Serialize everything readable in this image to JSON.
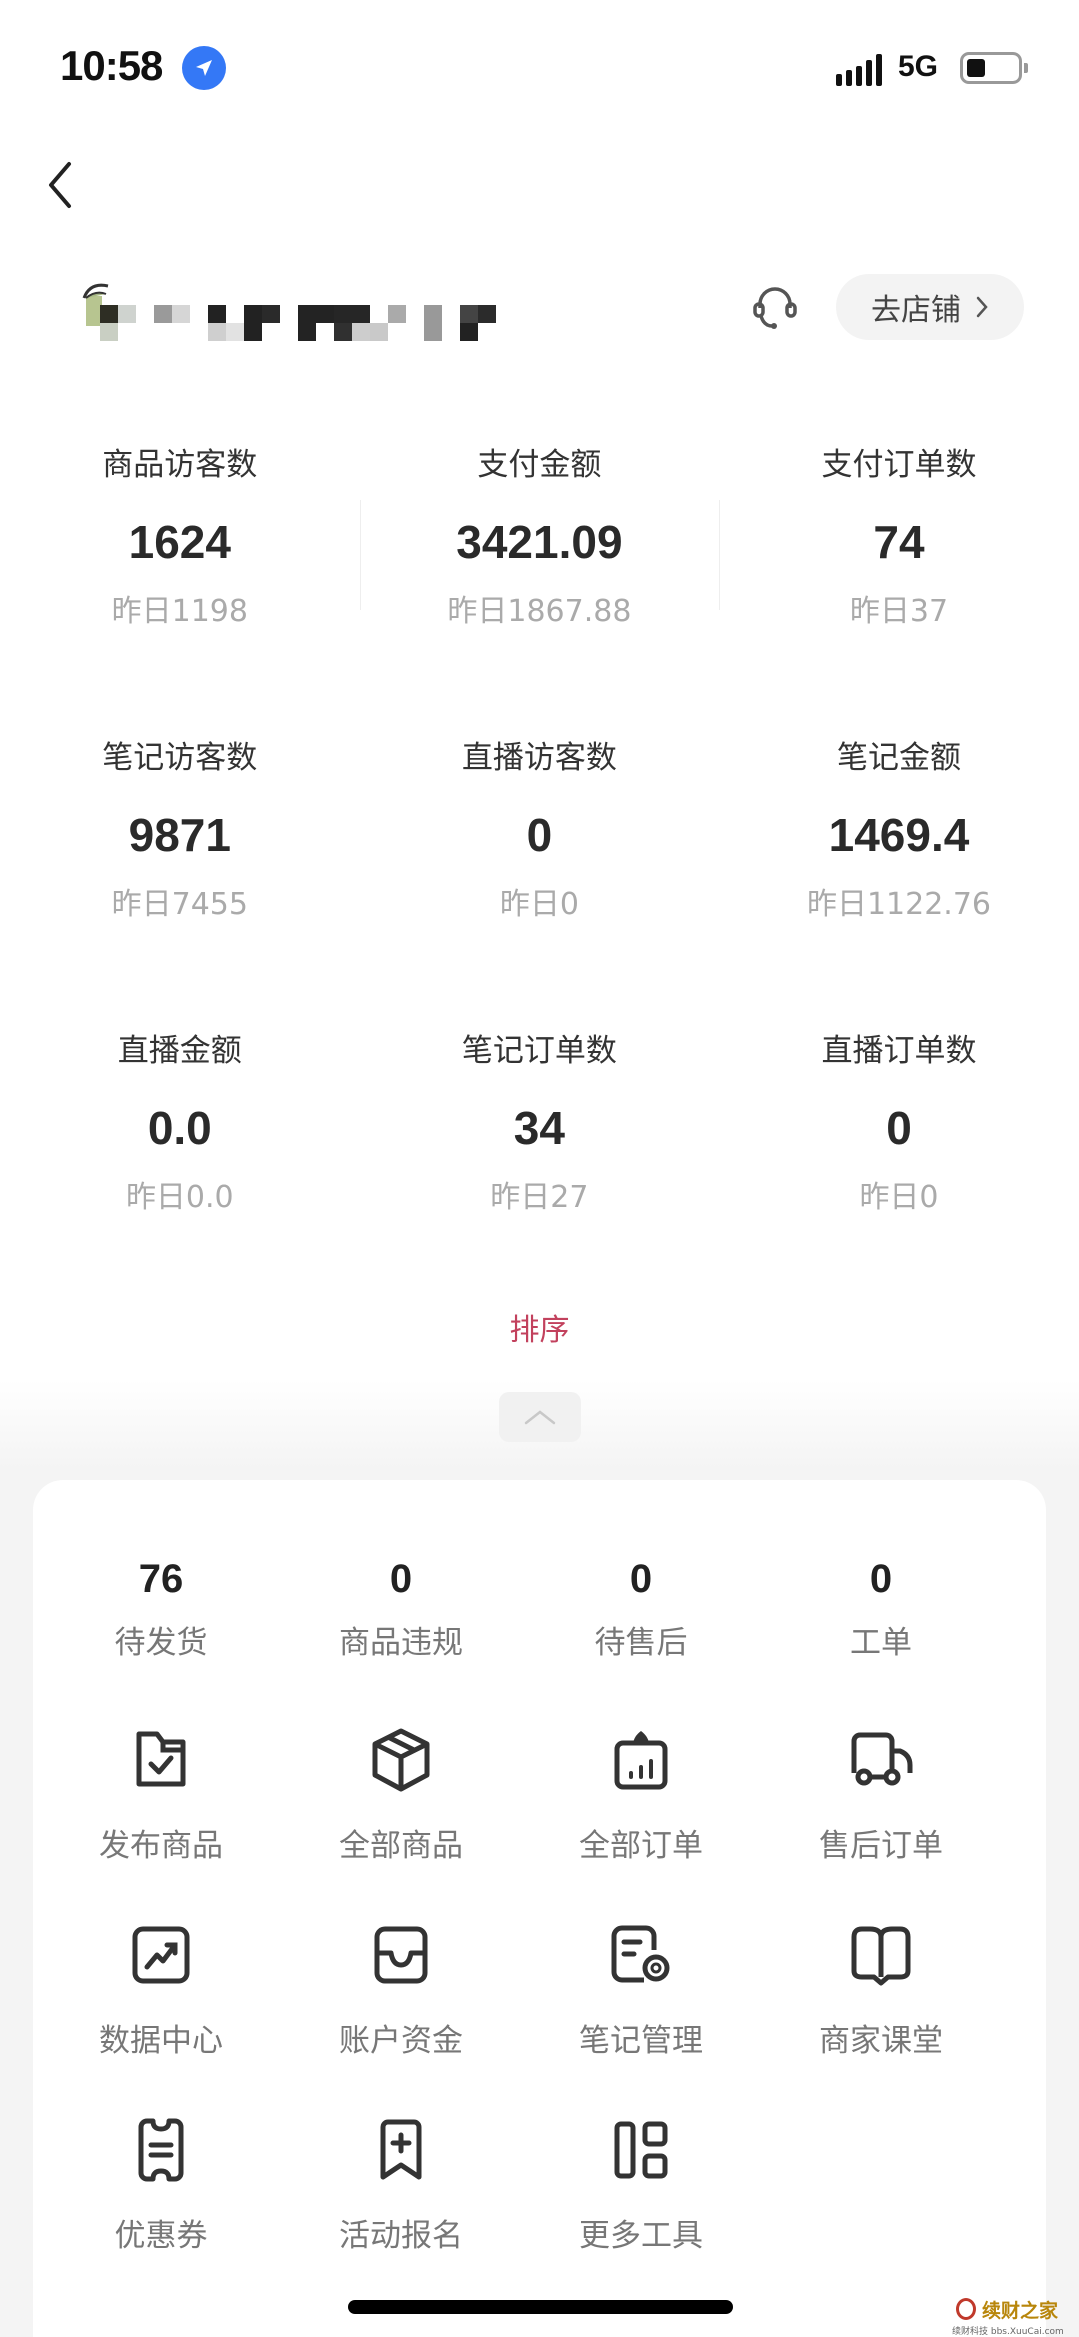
{
  "status_bar": {
    "time": "10:58",
    "network": "5G",
    "location_icon": "location-arrow-icon",
    "signal_icon": "signal-bars-icon",
    "battery_icon": "battery-icon",
    "battery_level": 0.3
  },
  "nav": {
    "back_icon": "chevron-left-icon"
  },
  "shop": {
    "name_redacted": true,
    "customer_service_icon": "headset-icon",
    "store_button_label": "去店铺",
    "store_button_icon": "chevron-right-icon"
  },
  "stats": [
    [
      {
        "label": "商品访客数",
        "value": "1624",
        "prev": "昨日1198"
      },
      {
        "label": "支付金额",
        "value": "3421.09",
        "prev": "昨日1867.88"
      },
      {
        "label": "支付订单数",
        "value": "74",
        "prev": "昨日37"
      }
    ],
    [
      {
        "label": "笔记访客数",
        "value": "9871",
        "prev": "昨日7455"
      },
      {
        "label": "直播访客数",
        "value": "0",
        "prev": "昨日0"
      },
      {
        "label": "笔记金额",
        "value": "1469.4",
        "prev": "昨日1122.76"
      }
    ],
    [
      {
        "label": "直播金额",
        "value": "0.0",
        "prev": "昨日0.0"
      },
      {
        "label": "笔记订单数",
        "value": "34",
        "prev": "昨日27"
      },
      {
        "label": "直播订单数",
        "value": "0",
        "prev": "昨日0"
      }
    ]
  ],
  "sort_label": "排序",
  "collapse_icon": "chevron-up-icon",
  "counts": [
    {
      "num": "76",
      "label": "待发货"
    },
    {
      "num": "0",
      "label": "商品违规"
    },
    {
      "num": "0",
      "label": "待售后"
    },
    {
      "num": "0",
      "label": "工单"
    }
  ],
  "tools": [
    [
      {
        "label": "发布商品",
        "icon": "folder-check-icon"
      },
      {
        "label": "全部商品",
        "icon": "box-icon"
      },
      {
        "label": "全部订单",
        "icon": "clipboard-chart-icon"
      },
      {
        "label": "售后订单",
        "icon": "truck-icon"
      }
    ],
    [
      {
        "label": "数据中心",
        "icon": "trend-chart-icon"
      },
      {
        "label": "账户资金",
        "icon": "wallet-tray-icon"
      },
      {
        "label": "笔记管理",
        "icon": "document-gear-icon"
      },
      {
        "label": "商家课堂",
        "icon": "open-book-icon"
      }
    ],
    [
      {
        "label": "优惠券",
        "icon": "coupon-icon"
      },
      {
        "label": "活动报名",
        "icon": "bookmark-plus-icon"
      },
      {
        "label": "更多工具",
        "icon": "grid-layout-icon"
      }
    ]
  ],
  "watermark": {
    "title": "续财之家",
    "subtitle": "续财科技 bbs.XuuCai.com"
  },
  "colors": {
    "accent": "#c2415d",
    "location_blue": "#3478f6",
    "text_primary": "#2a2a2a",
    "text_secondary": "#777777",
    "text_muted": "#aaaaaa"
  }
}
